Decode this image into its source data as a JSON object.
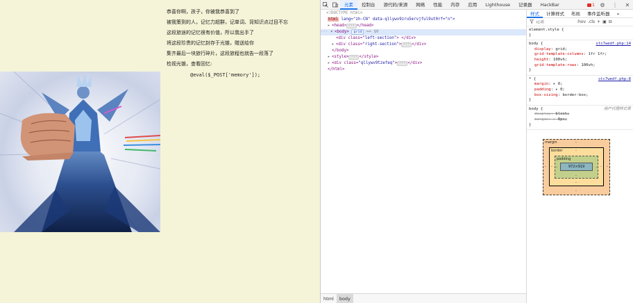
{
  "page": {
    "story_lines": [
      "恭喜你啊，孩子，你被我恭喜到了",
      "被我策到的人，记忆力超群，记单词、背知识点过目不忘",
      "这段旅途的记忆很有价值，所以我出手了",
      "将这段珍贵的记忆封存于光锥，赠送给你",
      "集齐最后一块旅行碎片，这段旅程也就告一段落了",
      "检视光锥，查看回忆:"
    ],
    "code_line": "@eval($_POST['memory']);"
  },
  "devtools": {
    "tabs": [
      "元素",
      "控制台",
      "源代码/来源",
      "网络",
      "性能",
      "内存",
      "应用",
      "Lighthouse",
      "记录器",
      "HackBar"
    ],
    "error_count": "1",
    "more_tabs": "»",
    "elements": {
      "doctype": "<!DOCTYPE html>",
      "html_tag": "html",
      "html_attrs": " lang=\"zh-CN\" data-qllywv9zru5ervjful9ut0rf=\"n\">",
      "head": "<head>",
      "head_close": "</head>",
      "body_open": "<body>",
      "body_badge": "grid",
      "body_eq": "== $0",
      "div1_tag": "<div class=",
      "div1_cls": "\"left-section\"",
      "div1_end": "> </div>",
      "div2_tag": "<div class=",
      "div2_cls": "\"right-section\"",
      "div2_end": "</div>",
      "body_close": "</body>",
      "style_open": "<style>",
      "style_close": "</style>",
      "div3_tag": "<div class=",
      "div3_cls": "\"qllywv9tzefeq\"",
      "div3_end": "</div>",
      "html_close": "</html>",
      "ellipsis": "···"
    },
    "breadcrumbs": [
      "html",
      "body"
    ],
    "styles": {
      "subtabs": [
        "样式",
        "计算样式",
        "布局",
        "事件监听器",
        "»"
      ],
      "filter_placeholder": "过滤",
      "hov": ":hov",
      "cls": ".cls",
      "element_style": "element.style {",
      "close_brace": "}",
      "rule1_selector": "body {",
      "rule1_source": "stc7wedf.php:14",
      "rule1_props": [
        {
          "name": "display",
          "value": "grid;"
        },
        {
          "name": "grid-template-columns",
          "value": "1fr 1fr;"
        },
        {
          "name": "height",
          "value": "100vh;"
        },
        {
          "name": "grid-template-rows",
          "value": "100vh;"
        }
      ],
      "rule2_selector": "* {",
      "rule2_source": "stc7wedf.php:8",
      "rule2_props": [
        {
          "name": "margin",
          "value": "▸ 0;"
        },
        {
          "name": "padding",
          "value": "▸ 0;"
        },
        {
          "name": "box-sizing",
          "value": "border-box;"
        }
      ],
      "rule3_selector": "body {",
      "rule3_source": "用户代理样式表",
      "rule3_props": [
        {
          "name": "display",
          "value": "block;"
        },
        {
          "name": "margin",
          "value": "▸ 8px;"
        }
      ]
    },
    "boxmodel": {
      "margin_label": "margin",
      "border_label": "border",
      "padding_label": "padding",
      "dash": "-",
      "content": "972×919"
    }
  }
}
